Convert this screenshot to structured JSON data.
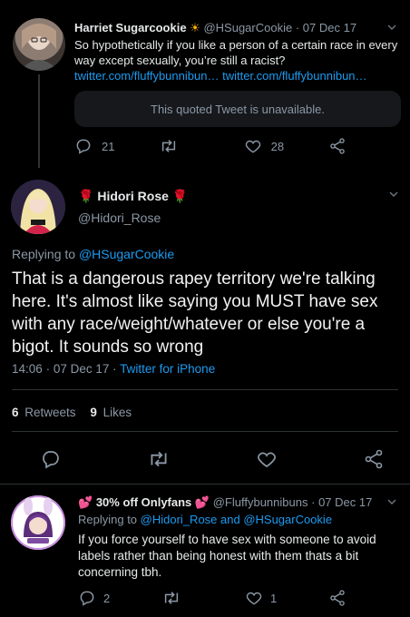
{
  "tweet1": {
    "name": "Harriet Sugarcookie",
    "name_emoji": "☀",
    "handle": "@HSugarCookie",
    "date": "07 Dec 17",
    "text": "So hypothetically if you like a person of a certain race in every way except sexually, you’re still a racist?",
    "link1": "twitter.com/fluffybunnibun…",
    "link2": "twitter.com/fluffybunnibun…",
    "quoted_text": "This quoted Tweet is unavailable.",
    "replies": "21",
    "likes": "28"
  },
  "tweet2": {
    "name": "Hidori Rose",
    "name_emoji": "🌹",
    "handle": "@Hidori_Rose",
    "replying_to_label": "Replying to",
    "replying_to_handle": "@HSugarCookie",
    "text": "That is a dangerous rapey territory we're talking here. It's almost like saying you MUST have sex with any race/weight/whatever or else you're a bigot. It sounds so wrong",
    "time": "14:06",
    "date": "07 Dec 17",
    "source": "Twitter for iPhone",
    "retweets_count": "6",
    "retweets_label": "Retweets",
    "likes_count": "9",
    "likes_label": "Likes"
  },
  "tweet3": {
    "name": "30% off Onlyfans",
    "name_emoji": "💕",
    "handle": "@Fluffybunnibuns",
    "date": "07 Dec 17",
    "replying_to_label": "Replying to",
    "replying_to_handles": "@Hidori_Rose and @HSugarCookie",
    "text": "If you force yourself to have sex with someone to avoid labels rather than being honest with them thats a bit concerning tbh.",
    "replies": "2",
    "likes": "1"
  },
  "colors": {
    "background": "#000000",
    "accent_link": "#1d9bf0",
    "muted": "#8b98a5",
    "divider": "#2f3336",
    "heart_emoji": "#f2396a"
  },
  "icons": [
    "reply-icon",
    "retweet-icon",
    "like-icon",
    "share-icon",
    "chevron-down-icon"
  ]
}
